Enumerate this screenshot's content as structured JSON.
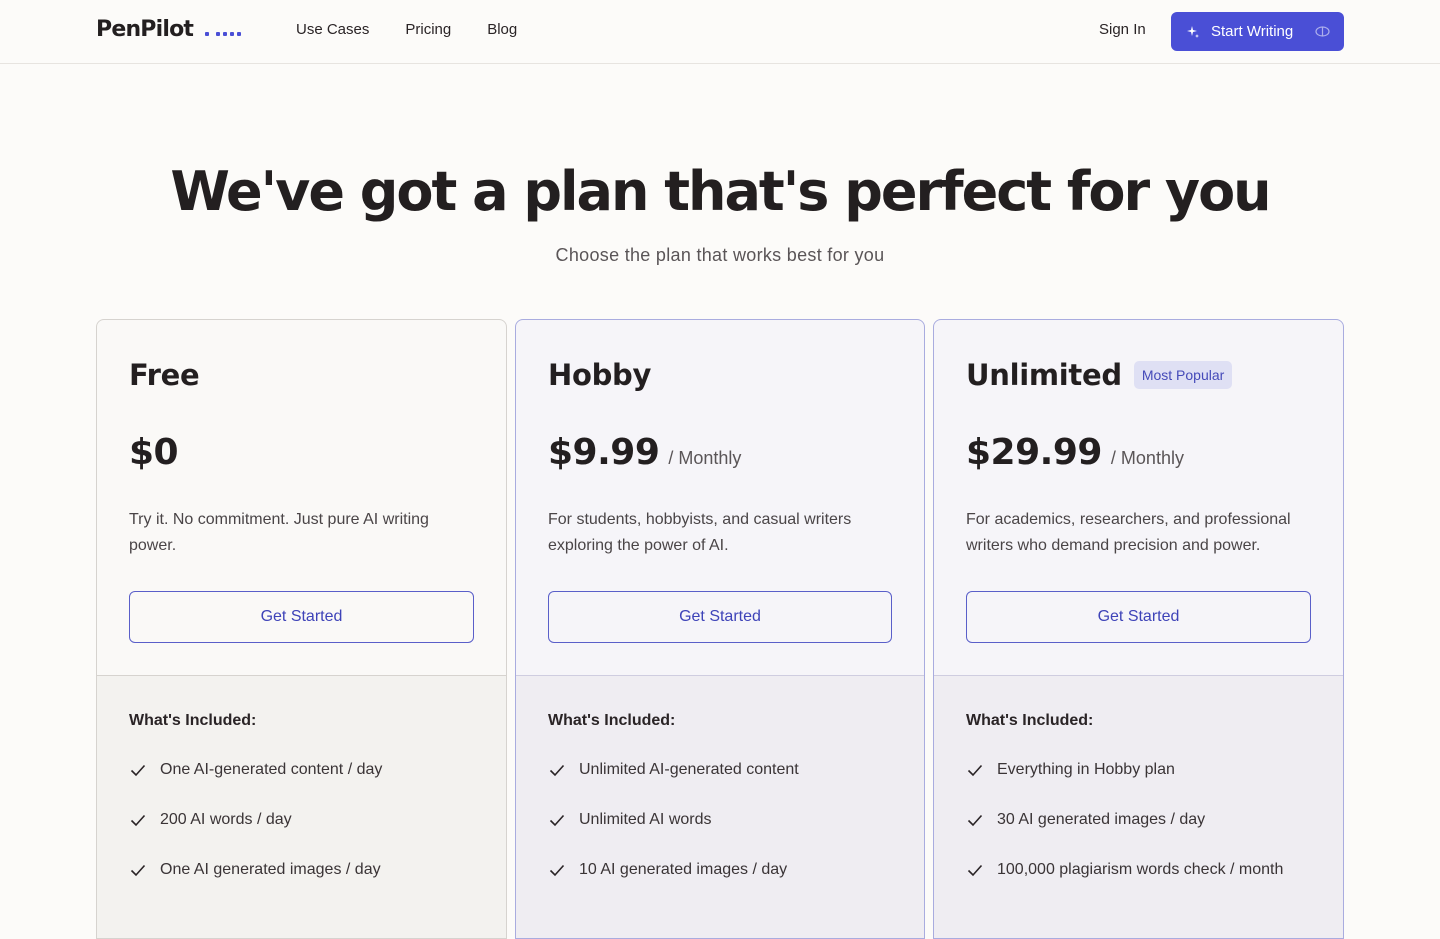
{
  "nav": {
    "logo": "PenPilot",
    "links": [
      "Use Cases",
      "Pricing",
      "Blog"
    ],
    "sign_in": "Sign In",
    "cta": "Start Writing",
    "accent_color": "#4a4fd6"
  },
  "hero": {
    "title": "We've got a plan that's perfect for you",
    "subtitle": "Choose the plan that works best for you"
  },
  "plans": [
    {
      "name": "Free",
      "price": "$0",
      "period": "",
      "badge": "",
      "description": "Try it. No commitment. Just pure AI writing power.",
      "cta": "Get Started",
      "included_title": "What's Included:",
      "features": [
        "One AI-generated content / day",
        "200 AI words / day",
        "One AI generated images / day"
      ]
    },
    {
      "name": "Hobby",
      "price": "$9.99",
      "period": "/ Monthly",
      "badge": "",
      "description": "For students, hobbyists, and casual writers exploring the power of AI.",
      "cta": "Get Started",
      "included_title": "What's Included:",
      "features": [
        "Unlimited AI-generated content",
        "Unlimited AI words",
        "10 AI generated images / day"
      ]
    },
    {
      "name": "Unlimited",
      "price": "$29.99",
      "period": "/ Monthly",
      "badge": "Most Popular",
      "description": "For academics, researchers, and professional writers who demand precision and power.",
      "cta": "Get Started",
      "included_title": "What's Included:",
      "features": [
        "Everything in Hobby plan",
        "30 AI generated images / day",
        "100,000 plagiarism words check / month"
      ]
    }
  ]
}
